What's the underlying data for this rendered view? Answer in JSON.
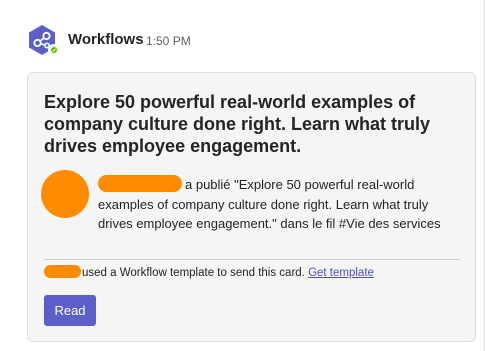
{
  "message": {
    "sender": "Workflows",
    "timestamp": "1:50 PM",
    "sender_icon": "workflows-icon",
    "presence_status": "available"
  },
  "card": {
    "title": "Explore 50 powerful real-world examples of company culture done right. Learn what truly drives employee engagement.",
    "body_text": "a publié \"Explore 50 powerful real-world examples of company culture done right. Learn what truly drives employee engagement.\" dans le fil #Vie des services",
    "footer_text": "used a Workflow template to send this card.",
    "footer_link": "Get template",
    "read_button": "Read"
  },
  "colors": {
    "workflows_brand": "#5b5fc7",
    "presence": "#6bb700",
    "redaction": "#ff8c00",
    "link": "#4f52b2",
    "button": "#5b5fc7"
  }
}
